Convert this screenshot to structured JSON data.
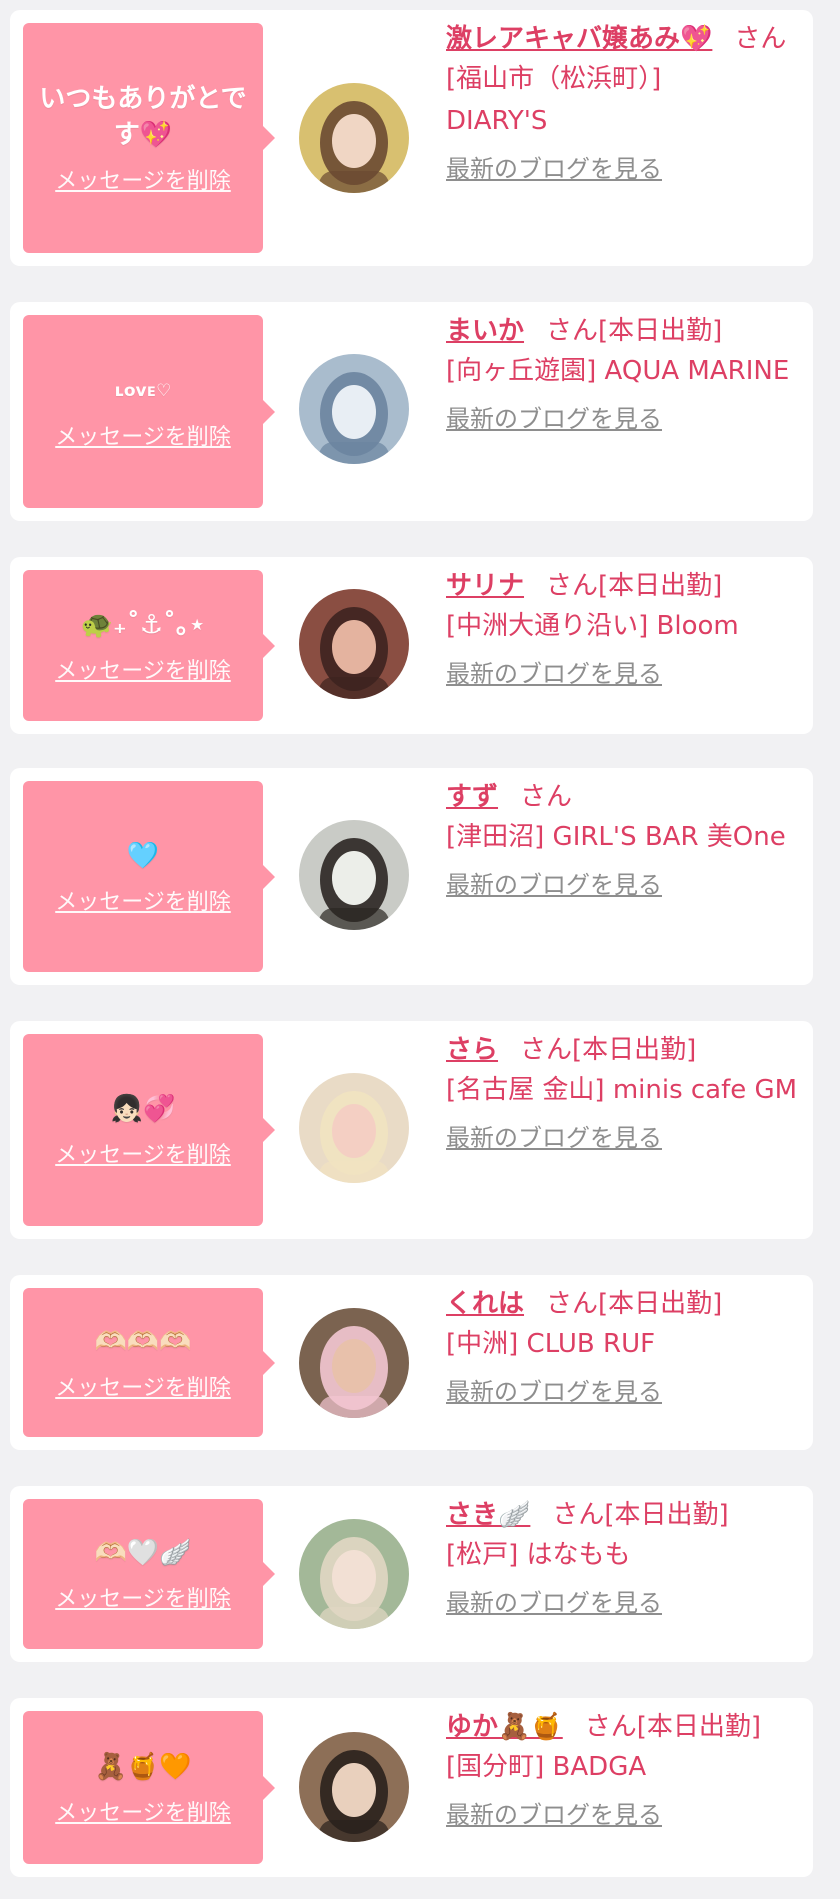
{
  "delete_label": "メッセージを削除",
  "blog_label": "最新のブログを見る",
  "items": [
    {
      "message": "いつもありがとです💖",
      "name": "激レアキャバ嬢あみ💖",
      "san": "さん",
      "status": "",
      "shop": "[福山市（松浜町）] DIARY'S"
    },
    {
      "message": "ʟᴏᴠᴇ♡",
      "name": "まいか",
      "san": "さん",
      "status": "[本日出勤]",
      "shop": "[向ヶ丘遊園] AQUA MARINE"
    },
    {
      "message": "🐢₊˚⚓︎˚｡⋆",
      "name": "サリナ",
      "san": "さん",
      "status": "[本日出勤]",
      "shop": "[中洲大通り沿い] Bloom"
    },
    {
      "message": "🩵",
      "name": "すず",
      "san": "さん",
      "status": "",
      "shop": "[津田沼] GIRL'S BAR 美One"
    },
    {
      "message": "👧🏻💞",
      "name": "さら",
      "san": "さん",
      "status": "[本日出勤]",
      "shop": "[名古屋 金山] minis cafe GM"
    },
    {
      "message": "🫶🏻🫶🏻🫶🏻",
      "name": "くれは",
      "san": "さん",
      "status": "[本日出勤]",
      "shop": "[中洲] CLUB RUF"
    },
    {
      "message": "🫶🏻🤍🪽",
      "name": "さき🪽",
      "san": "さん",
      "status": "[本日出勤]",
      "shop": "[松戸] はなもも"
    },
    {
      "message": "🧸🍯🧡",
      "name": "ゆか🧸🍯",
      "san": "さん",
      "status": "[本日出勤]",
      "shop": "[国分町] BADGA"
    }
  ]
}
